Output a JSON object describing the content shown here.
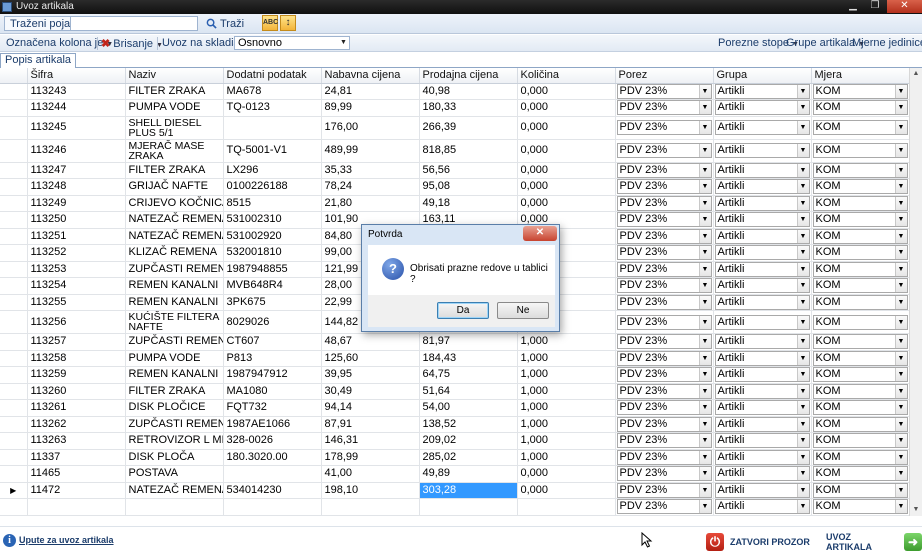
{
  "window": {
    "title": "Uvoz artikala",
    "min": "▁",
    "max": "❐",
    "close": "✕"
  },
  "toolbar1": {
    "search_label": "Traženi pojam",
    "search_value": "",
    "search_button": "Traži",
    "icon1_text": "ABC",
    "icon2_text": "↕"
  },
  "toolbar2": {
    "marked_column": "Označena kolona je",
    "delete": "Brisanje",
    "warehouse_label": "Uvoz na skladište :",
    "warehouse_value": "Osnovno",
    "tax_rates": "Porezne stope",
    "article_groups": "Grupe artikala",
    "units": "Mjerne jedinice"
  },
  "tab": {
    "label": "Popis artikala"
  },
  "grid": {
    "columns": [
      "Šifra",
      "Naziv",
      "Dodatni podatak",
      "Nabavna cijena",
      "Prodajna cijena",
      "Količina",
      "Porez",
      "Grupa",
      "Mjera"
    ],
    "rows": [
      {
        "sifra": "113243",
        "naziv": "FILTER ZRAKA",
        "dodatni": "MA678",
        "nabavna": "24,81",
        "prodajna": "40,98",
        "kolicina": "0,000",
        "porez": "PDV 23%",
        "grupa": "Artikli",
        "mjera": "KOM"
      },
      {
        "sifra": "113244",
        "naziv": "PUMPA VODE",
        "dodatni": "TQ-0123",
        "nabavna": "89,99",
        "prodajna": "180,33",
        "kolicina": "0,000",
        "porez": "PDV 23%",
        "grupa": "Artikli",
        "mjera": "KOM"
      },
      {
        "sifra": "113245",
        "naziv": "SHELL DIESEL PLUS 5/1",
        "dodatni": "",
        "nabavna": "176,00",
        "prodajna": "266,39",
        "kolicina": "0,000",
        "porez": "PDV 23%",
        "grupa": "Artikli",
        "mjera": "KOM"
      },
      {
        "sifra": "113246",
        "naziv": "MJERAČ MASE ZRAKA",
        "dodatni": "TQ-5001-V1",
        "nabavna": "489,99",
        "prodajna": "818,85",
        "kolicina": "0,000",
        "porez": "PDV 23%",
        "grupa": "Artikli",
        "mjera": "KOM"
      },
      {
        "sifra": "113247",
        "naziv": "FILTER ZRAKA",
        "dodatni": "LX296",
        "nabavna": "35,33",
        "prodajna": "56,56",
        "kolicina": "0,000",
        "porez": "PDV 23%",
        "grupa": "Artikli",
        "mjera": "KOM"
      },
      {
        "sifra": "113248",
        "naziv": "GRIJAČ NAFTE",
        "dodatni": "0100226188",
        "nabavna": "78,24",
        "prodajna": "95,08",
        "kolicina": "0,000",
        "porez": "PDV 23%",
        "grupa": "Artikli",
        "mjera": "KOM"
      },
      {
        "sifra": "113249",
        "naziv": "CRIJEVO KOČNICA",
        "dodatni": "8515",
        "nabavna": "21,80",
        "prodajna": "49,18",
        "kolicina": "0,000",
        "porez": "PDV 23%",
        "grupa": "Artikli",
        "mjera": "KOM"
      },
      {
        "sifra": "113250",
        "naziv": "NATEZAČ REMENA",
        "dodatni": "531002310",
        "nabavna": "101,90",
        "prodajna": "163,11",
        "kolicina": "0,000",
        "porez": "PDV 23%",
        "grupa": "Artikli",
        "mjera": "KOM"
      },
      {
        "sifra": "113251",
        "naziv": "NATEZAČ REMENA",
        "dodatni": "531002920",
        "nabavna": "84,80",
        "prodajna": "",
        "kolicina": "0,000",
        "porez": "PDV 23%",
        "grupa": "Artikli",
        "mjera": "KOM"
      },
      {
        "sifra": "113252",
        "naziv": "KLIZAČ REMENA",
        "dodatni": "532001810",
        "nabavna": "99,00",
        "prodajna": "",
        "kolicina": "",
        "porez": "PDV 23%",
        "grupa": "Artikli",
        "mjera": "KOM"
      },
      {
        "sifra": "113253",
        "naziv": "ZUPČASTI REMEN",
        "dodatni": "1987948855",
        "nabavna": "121,99",
        "prodajna": "",
        "kolicina": "",
        "porez": "PDV 23%",
        "grupa": "Artikli",
        "mjera": "KOM"
      },
      {
        "sifra": "113254",
        "naziv": "REMEN KANALNI",
        "dodatni": "MVB648R4",
        "nabavna": "28,00",
        "prodajna": "",
        "kolicina": "",
        "porez": "PDV 23%",
        "grupa": "Artikli",
        "mjera": "KOM"
      },
      {
        "sifra": "113255",
        "naziv": "REMEN KANALNI",
        "dodatni": "3PK675",
        "nabavna": "22,99",
        "prodajna": "",
        "kolicina": "",
        "porez": "PDV 23%",
        "grupa": "Artikli",
        "mjera": "KOM"
      },
      {
        "sifra": "113256",
        "naziv": "KUĆIŠTE FILTERA NAFTE",
        "dodatni": "8029026",
        "nabavna": "144,82",
        "prodajna": "",
        "kolicina": "",
        "porez": "PDV 23%",
        "grupa": "Artikli",
        "mjera": "KOM"
      },
      {
        "sifra": "113257",
        "naziv": "ZUPČASTI REMEN",
        "dodatni": "CT607",
        "nabavna": "48,67",
        "prodajna": "81,97",
        "kolicina": "1,000",
        "porez": "PDV 23%",
        "grupa": "Artikli",
        "mjera": "KOM"
      },
      {
        "sifra": "113258",
        "naziv": "PUMPA VODE",
        "dodatni": "P813",
        "nabavna": "125,60",
        "prodajna": "184,43",
        "kolicina": "1,000",
        "porez": "PDV 23%",
        "grupa": "Artikli",
        "mjera": "KOM"
      },
      {
        "sifra": "113259",
        "naziv": "REMEN KANALNI",
        "dodatni": "1987947912",
        "nabavna": "39,95",
        "prodajna": "64,75",
        "kolicina": "1,000",
        "porez": "PDV 23%",
        "grupa": "Artikli",
        "mjera": "KOM"
      },
      {
        "sifra": "113260",
        "naziv": "FILTER ZRAKA",
        "dodatni": "MA1080",
        "nabavna": "30,49",
        "prodajna": "51,64",
        "kolicina": "1,000",
        "porez": "PDV 23%",
        "grupa": "Artikli",
        "mjera": "KOM"
      },
      {
        "sifra": "113261",
        "naziv": "DISK PLOČICE",
        "dodatni": "FQT732",
        "nabavna": "94,14",
        "prodajna": "54,00",
        "kolicina": "1,000",
        "porez": "PDV 23%",
        "grupa": "Artikli",
        "mjera": "KOM"
      },
      {
        "sifra": "113262",
        "naziv": "ZUPČASTI REMEN",
        "dodatni": "1987AE1066",
        "nabavna": "87,91",
        "prodajna": "138,52",
        "kolicina": "1,000",
        "porez": "PDV 23%",
        "grupa": "Artikli",
        "mjera": "KOM"
      },
      {
        "sifra": "113263",
        "naziv": "RETROVIZOR L MEH",
        "dodatni": "328-0026",
        "nabavna": "146,31",
        "prodajna": "209,02",
        "kolicina": "1,000",
        "porez": "PDV 23%",
        "grupa": "Artikli",
        "mjera": "KOM"
      },
      {
        "sifra": "11337",
        "naziv": "DISK PLOČA",
        "dodatni": "180.3020.00",
        "nabavna": "178,99",
        "prodajna": "285,02",
        "kolicina": "1,000",
        "porez": "PDV 23%",
        "grupa": "Artikli",
        "mjera": "KOM"
      },
      {
        "sifra": "11465",
        "naziv": "POSTAVA",
        "dodatni": "",
        "nabavna": "41,00",
        "prodajna": "49,89",
        "kolicina": "0,000",
        "porez": "PDV 23%",
        "grupa": "Artikli",
        "mjera": "KOM"
      },
      {
        "sifra": "11472",
        "naziv": "NATEZAČ REMENA",
        "dodatni": "534014230",
        "nabavna": "198,10",
        "prodajna": "303,28",
        "kolicina": "0,000",
        "porez": "PDV 23%",
        "grupa": "Artikli",
        "mjera": "KOM",
        "current": true
      },
      {
        "sifra": "",
        "naziv": "",
        "dodatni": "",
        "nabavna": "",
        "prodajna": "",
        "kolicina": "",
        "porez": "PDV 23%",
        "grupa": "Artikli",
        "mjera": "KOM"
      }
    ]
  },
  "bottom": {
    "help_link": "Upute za uvoz artikala",
    "close_button": "ZATVORI PROZOR",
    "import_button": "UVOZ ARTIKALA"
  },
  "dialog": {
    "title": "Potvrda",
    "message": "Obrisati prazne redove u tablici ?",
    "yes": "Da",
    "no": "Ne",
    "close": "✕",
    "icon": "?"
  },
  "colors": {
    "selection": "#3399ff",
    "dialog_frame": "#d9e6f5",
    "close_red": "#c7432f"
  }
}
